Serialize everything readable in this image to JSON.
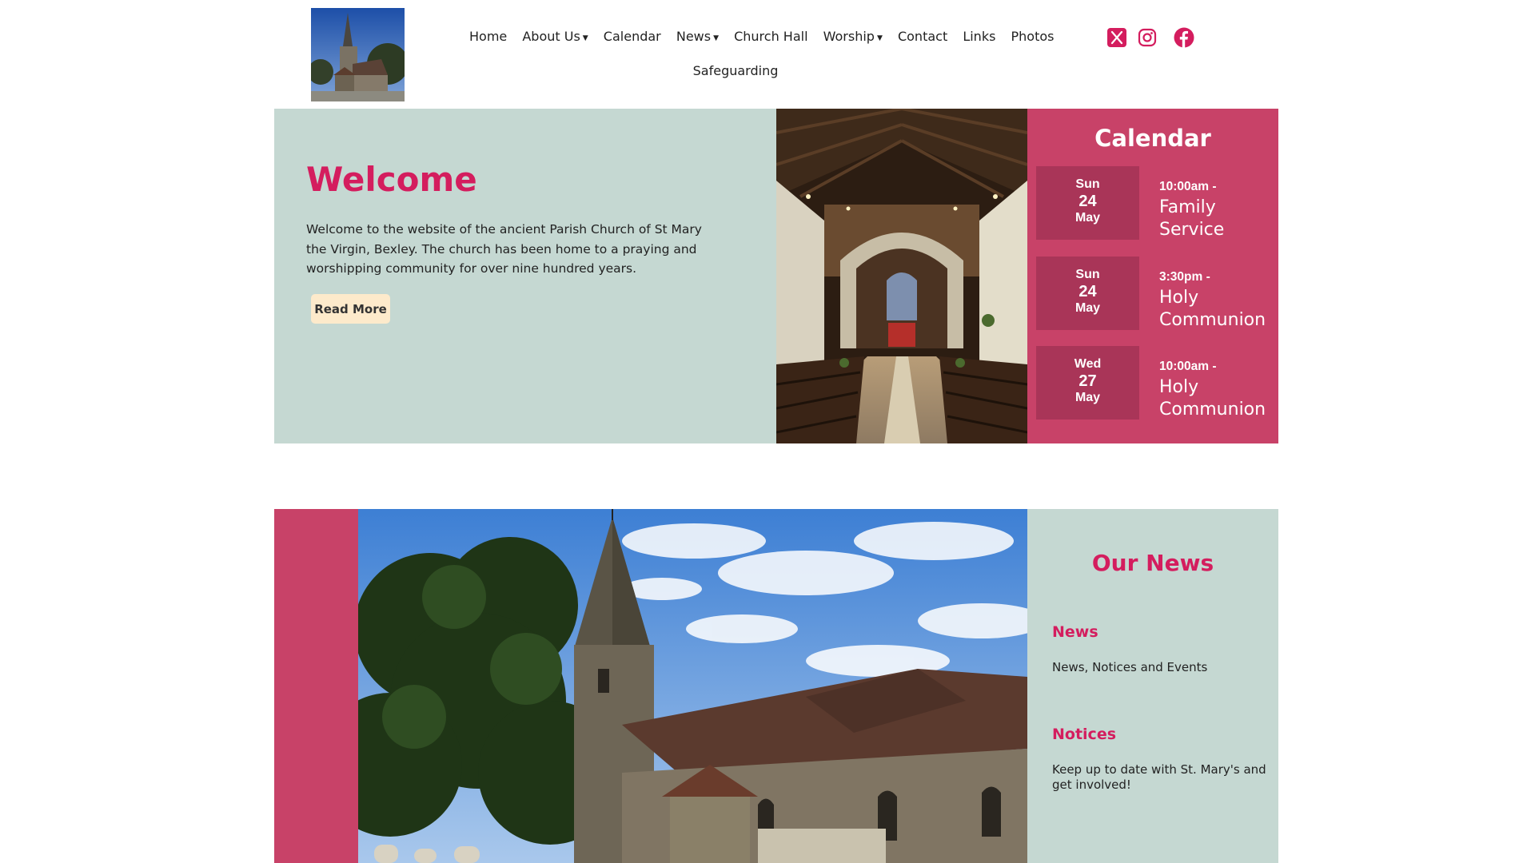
{
  "header": {
    "nav": [
      {
        "label": "Home",
        "dropdown": false
      },
      {
        "label": "About Us",
        "dropdown": true
      },
      {
        "label": "Calendar",
        "dropdown": false
      },
      {
        "label": "News",
        "dropdown": true
      },
      {
        "label": "Church Hall",
        "dropdown": false
      },
      {
        "label": "Worship",
        "dropdown": true
      },
      {
        "label": "Contact",
        "dropdown": false
      },
      {
        "label": "Links",
        "dropdown": false
      },
      {
        "label": "Photos",
        "dropdown": false
      }
    ],
    "nav_row2": {
      "label": "Safeguarding"
    },
    "dropdown_caret": "▼",
    "social": [
      {
        "icon": "x-twitter-icon"
      },
      {
        "icon": "instagram-icon"
      },
      {
        "icon": "facebook-icon"
      }
    ],
    "accent_color": "#d41d5e"
  },
  "welcome": {
    "title": "Welcome",
    "text": "Welcome to the website of the ancient Parish Church of St Mary the Virgin, Bexley.  The church has been home to a praying and worshipping community for over nine hundred years.",
    "button": "Read More"
  },
  "calendar": {
    "title": "Calendar",
    "events": [
      {
        "dow": "Sun",
        "day": "24",
        "month": "May",
        "time": "10:00am -",
        "name": "Family Service"
      },
      {
        "dow": "Sun",
        "day": "24",
        "month": "May",
        "time": "3:30pm -",
        "name": "Holy Communion"
      },
      {
        "dow": "Wed",
        "day": "27",
        "month": "May",
        "time": "10:00am -",
        "name": "Holy Communion"
      }
    ]
  },
  "news": {
    "title": "Our News",
    "items": [
      {
        "heading": "News",
        "text": "News, Notices and Events"
      },
      {
        "heading": "Notices",
        "text": "Keep up to date with St. Mary's and get involved!"
      }
    ]
  },
  "colors": {
    "pink_panel": "#c84268",
    "date_box": "#a93558",
    "sage_panel": "#c5d8d2",
    "button_bg": "#fdeacb"
  }
}
